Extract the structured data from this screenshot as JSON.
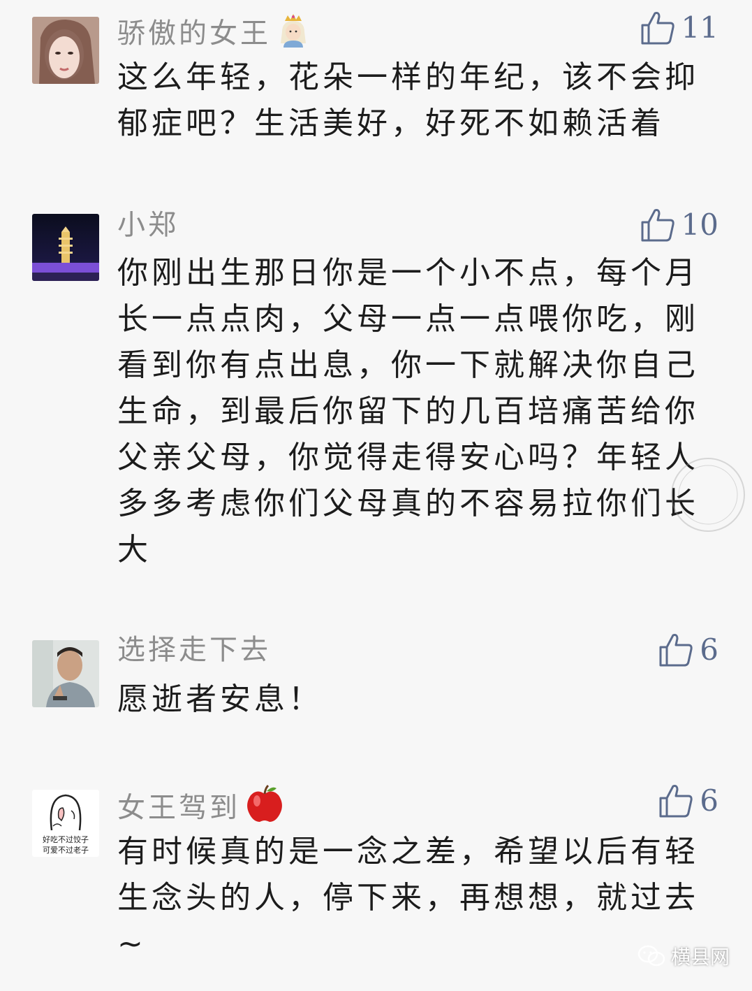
{
  "comments": [
    {
      "username": "骄傲的女王",
      "name_emoji": "princess-emoji",
      "likes": "11",
      "text": "这么年轻，花朵一样的年纪，该不会抑郁症吧？生活美好，好死不如赖活着"
    },
    {
      "username": "小郑",
      "likes": "10",
      "text": "你刚出生那日你是一个小不点，每个月长一点点肉，父母一点一点喂你吃，刚看到你有点出息，你一下就解决你自己生命，到最后你留下的几百培痛苦给你父亲父母，你觉得走得安心吗？年轻人多多考虑你们父母真的不容易拉你们长大"
    },
    {
      "username": "选择走下去",
      "likes": "6",
      "text": "愿逝者安息！"
    },
    {
      "username": "女王驾到",
      "name_emoji": "apple-emoji",
      "likes": "6",
      "text": "有时候真的是一念之差，希望以后有轻生念头的人，停下来，再想想，就过去~",
      "avatar_text_line1": "好吃不过饺子",
      "avatar_text_line2": "可爱不过老子"
    }
  ],
  "footer": {
    "label": "横县网"
  },
  "colors": {
    "background": "#f7f7f7",
    "username": "#8c8c8c",
    "like_accent": "#5b6b8c",
    "text": "#1c1c1c"
  }
}
